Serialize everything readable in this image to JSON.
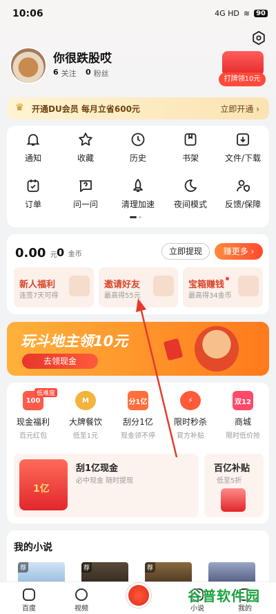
{
  "status_bar": {
    "time": "10:06",
    "signal": "4G HD",
    "battery": "90"
  },
  "profile": {
    "name": "你很跌股哎",
    "following_count": "6",
    "following_label": "关注",
    "fans_count": "0",
    "fans_label": "粉丝",
    "gift_label": "打牌领10元"
  },
  "vip": {
    "text": "开通DU会员 每月立省600元",
    "action": "立即开通 ›"
  },
  "grid": [
    {
      "label": "通知",
      "icon": "bell-icon"
    },
    {
      "label": "收藏",
      "icon": "star-icon"
    },
    {
      "label": "历史",
      "icon": "clock-icon"
    },
    {
      "label": "书架",
      "icon": "bookmark-icon"
    },
    {
      "label": "文件/下载",
      "icon": "download-icon"
    },
    {
      "label": "订单",
      "icon": "order-icon"
    },
    {
      "label": "问一问",
      "icon": "question-icon"
    },
    {
      "label": "清理加速",
      "icon": "rocket-icon"
    },
    {
      "label": "夜间模式",
      "icon": "moon-icon"
    },
    {
      "label": "反馈/保障",
      "icon": "shield-icon"
    }
  ],
  "wallet": {
    "cash": "0.00",
    "cash_unit": "元",
    "coins": "0",
    "coins_unit": "金币",
    "withdraw": "立即提现",
    "earn_more": "赚更多 ›",
    "tasks": [
      {
        "title": "新人福利",
        "sub": "连签7天可得"
      },
      {
        "title": "邀请好友",
        "sub": "最高得55元"
      },
      {
        "title": "宝箱赚钱",
        "sub": "最高得34金币"
      }
    ]
  },
  "banner": {
    "title": "玩斗地主领10元",
    "button": "去领现金"
  },
  "services": {
    "tag": "低难度",
    "items": [
      {
        "name": "现金福利",
        "desc": "百元红包",
        "icon": "100",
        "color": "#ff5a4a"
      },
      {
        "name": "大牌餐饮",
        "desc": "低至1元",
        "icon": "M",
        "color": "#f3b33d"
      },
      {
        "name": "刮分1亿",
        "desc": "现金领不停",
        "icon": "分1亿",
        "color": "#ff6f3d"
      },
      {
        "name": "限时秒杀",
        "desc": "官方补贴",
        "icon": "⚡",
        "color": "#ff5a3a"
      },
      {
        "name": "商城",
        "desc": "限时低价抢",
        "icon": "双12",
        "color": "#ff4a6a"
      }
    ],
    "promo_main": {
      "title": "刮1亿现金",
      "sub": "必中现金 随时提现",
      "img_text": "1亿"
    },
    "promo_side": {
      "title": "百亿补贴",
      "sub": "低至5折"
    }
  },
  "novels": {
    "title": "我的小说",
    "badge": "荐"
  },
  "tabbar": [
    {
      "label": "百度"
    },
    {
      "label": "视频"
    },
    {
      "label": "小说"
    },
    {
      "label": "我的"
    }
  ],
  "watermark": "谷普软件园",
  "colors": {
    "accent": "#ff4a2e",
    "vip_text": "#6b4310",
    "task_title": "#d8452a"
  }
}
